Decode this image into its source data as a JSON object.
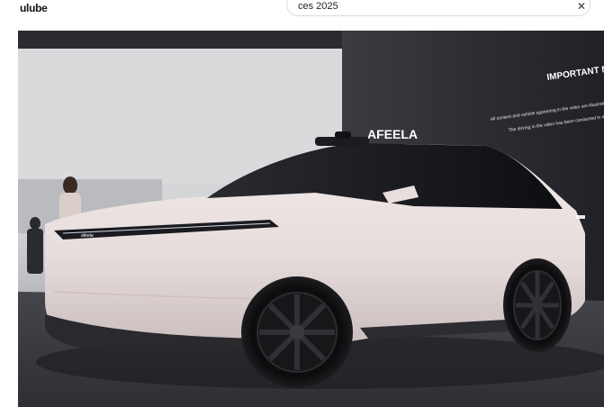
{
  "app": {
    "logo_text": "ulube"
  },
  "search": {
    "query": "ces 2025",
    "clear_icon": "close-icon"
  },
  "video": {
    "wall_brand": "AFEELA",
    "notice_title": "IMPORTANT NOT",
    "notice_line1": "All content and vehicle appearing in the video are illustrative.",
    "notice_line2": "The driving in the video has been conducted in a controlled",
    "badge": "afeela",
    "colors": {
      "car_body": "#e9e0df",
      "wall_dark": "#23252a",
      "floor": "#3a3b40"
    }
  }
}
